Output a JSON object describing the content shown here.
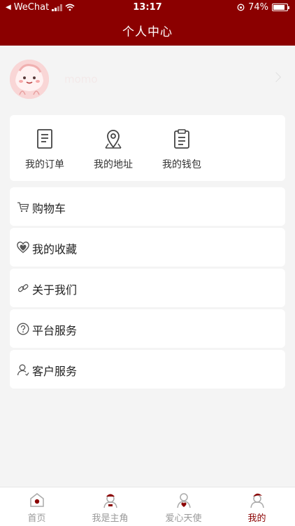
{
  "status_bar": {
    "carrier": "WeChat",
    "time": "13:17",
    "battery": "74%"
  },
  "header": {
    "title": "个人中心"
  },
  "profile": {
    "username": "momo"
  },
  "quick_actions": [
    {
      "label": "我的订单",
      "icon": "order-document-icon"
    },
    {
      "label": "我的地址",
      "icon": "location-pin-icon"
    },
    {
      "label": "我的钱包",
      "icon": "wallet-clipboard-icon"
    }
  ],
  "menu": [
    {
      "label": "购物车",
      "icon": "cart-icon"
    },
    {
      "label": "我的收藏",
      "icon": "heart-icon"
    },
    {
      "label": "关于我们",
      "icon": "link-icon"
    },
    {
      "label": "平台服务",
      "icon": "question-icon"
    },
    {
      "label": "客户服务",
      "icon": "user-icon"
    }
  ],
  "tabs": [
    {
      "label": "首页",
      "icon": "home-icon",
      "active": false
    },
    {
      "label": "我是主角",
      "icon": "protagonist-icon",
      "active": false
    },
    {
      "label": "爱心天使",
      "icon": "angel-heart-icon",
      "active": false
    },
    {
      "label": "我的",
      "icon": "profile-icon",
      "active": true
    }
  ],
  "colors": {
    "brand": "#8b0000",
    "background": "#f4f4f4",
    "inactive_tab": "#9a9a9a"
  }
}
